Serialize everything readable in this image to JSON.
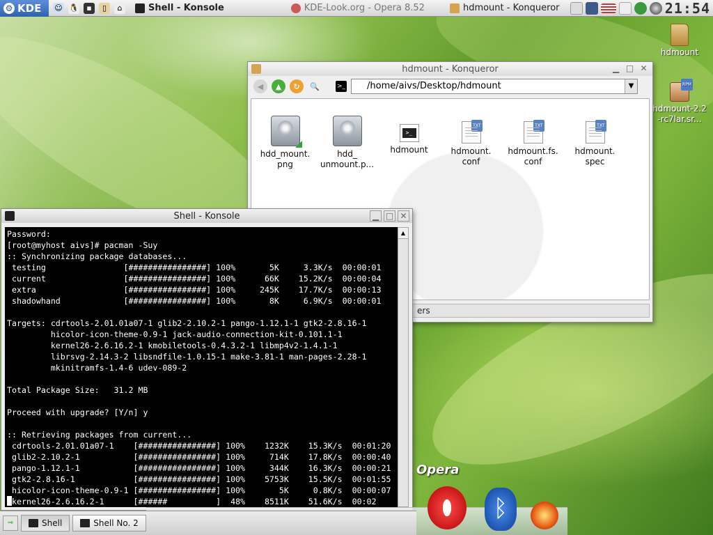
{
  "top_panel": {
    "kde_label": "KDE",
    "tasks": [
      {
        "label": "Shell - Konsole",
        "state": "active"
      },
      {
        "label": "KDE-Look.org - Opera 8.52",
        "state": "inactive"
      },
      {
        "label": "hdmount - Konqueror",
        "state": "normal"
      }
    ],
    "clock": "21:54"
  },
  "desktop_icons": {
    "folder": "hdmount",
    "rpm": "hdmount-2.2-rc7lar.sr..."
  },
  "konqueror": {
    "title": "hdmount - Konqueror",
    "location": "/home/aivs/Desktop/hdmount",
    "files": [
      {
        "name": "hdd_mount.\npng",
        "icon": "disk-image-icon"
      },
      {
        "name": "hdd_\nunmount.p...",
        "icon": "disk-image-icon"
      },
      {
        "name": "hdmount",
        "icon": "terminal-script-icon"
      },
      {
        "name": "hdmount.\nconf",
        "icon": "text-file-icon"
      },
      {
        "name": "hdmount.fs.\nconf",
        "icon": "text-file-icon"
      },
      {
        "name": "hdmount.\nspec",
        "icon": "text-file-icon"
      }
    ],
    "status_text": "ers"
  },
  "konsole": {
    "title": "Shell - Konsole",
    "lines": [
      "Password:",
      "[root@myhost aivs]# pacman -Suy",
      ":: Synchronizing package databases...",
      " testing                [################] 100%       5K     3.3K/s  00:00:01",
      " current                [################] 100%      66K    15.2K/s  00:00:04",
      " extra                  [################] 100%     245K    17.7K/s  00:00:13",
      " shadowhand             [################] 100%       8K     6.9K/s  00:00:01",
      "",
      "Targets: cdrtools-2.01.01a07-1 glib2-2.10.2-1 pango-1.12.1-1 gtk2-2.8.16-1",
      "         hicolor-icon-theme-0.9-1 jack-audio-connection-kit-0.101.1-1",
      "         kernel26-2.6.16.2-1 kmobiletools-0.4.3.2-1 libmp4v2-1.4.1-1",
      "         librsvg-2.14.3-2 libsndfile-1.0.15-1 make-3.81-1 man-pages-2.28-1",
      "         mkinitramfs-1.4-6 udev-089-2",
      "",
      "Total Package Size:   31.2 MB",
      "",
      "Proceed with upgrade? [Y/n] y",
      "",
      ":: Retrieving packages from current...",
      " cdrtools-2.01.01a07-1    [################] 100%    1232K    15.3K/s  00:01:20",
      " glib2-2.10.2-1           [################] 100%     714K    17.8K/s  00:00:40",
      " pango-1.12.1-1           [################] 100%     344K    16.3K/s  00:00:21",
      " gtk2-2.8.16-1            [################] 100%    5753K    15.5K/s  00:01:55",
      " hicolor-icon-theme-0.9-1 [################] 100%       5K     0.8K/s  00:00:07",
      "kernel26-2.6.16.2-1      [######          ]  48%    8511K    51.6K/s  00:02"
    ]
  },
  "bottom_panel": {
    "tasks": [
      {
        "label": "Shell"
      },
      {
        "label": "Shell No. 2"
      }
    ],
    "opera_label": "Opera"
  }
}
